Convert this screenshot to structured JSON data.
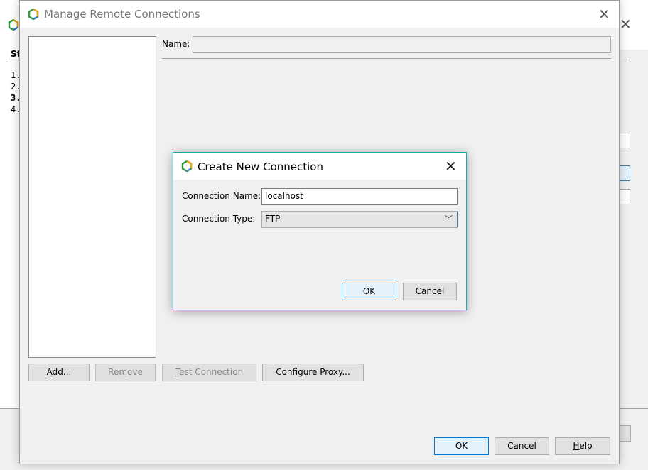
{
  "background_window": {
    "steps_heading": "St",
    "steps": [
      "1.",
      "2.",
      "3.",
      "4."
    ]
  },
  "manage": {
    "title": "Manage Remote Connections",
    "name_label": "Name:",
    "name_value": "",
    "buttons": {
      "add": {
        "mnemonic": "A",
        "rest": "dd..."
      },
      "remove": {
        "first": "Re",
        "mnemonic": "m",
        "rest": "ove"
      },
      "test": {
        "mnemonic": "T",
        "rest": "est Connection"
      },
      "proxy": {
        "first": "Confi",
        "mnemonic": "g",
        "rest": "ure Proxy..."
      }
    },
    "ok": "OK",
    "cancel": "Cancel",
    "help": {
      "mnemonic": "H",
      "rest": "elp"
    }
  },
  "create": {
    "title": "Create New Connection",
    "connection_name_label": "Connection Name:",
    "connection_name_value": "localhost",
    "connection_type_label": "Connection Type:",
    "connection_type_value": "FTP",
    "ok": "OK",
    "cancel": "Cancel"
  },
  "icons": {
    "close": "✕",
    "chevron": "﹀"
  },
  "colors": {
    "focus_border": "#0078d7",
    "dialog_border": "#1aa3c3",
    "app_bg": "#f0f0f0"
  }
}
